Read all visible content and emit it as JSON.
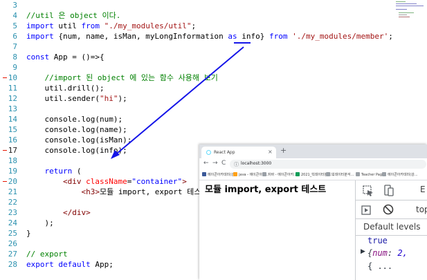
{
  "editor": {
    "lines": [
      {
        "num": "3",
        "tokens": []
      },
      {
        "num": "4",
        "tokens": [
          {
            "t": "//util 은 object 이다.",
            "c": "cm"
          }
        ]
      },
      {
        "num": "5",
        "tokens": [
          {
            "t": "import",
            "c": "kw"
          },
          {
            "t": " util ",
            "c": "pl"
          },
          {
            "t": "from",
            "c": "kw"
          },
          {
            "t": " ",
            "c": "pl"
          },
          {
            "t": "\"./my_modules/util\"",
            "c": "st"
          },
          {
            "t": ";",
            "c": "pl"
          }
        ]
      },
      {
        "num": "6",
        "tokens": [
          {
            "t": "import",
            "c": "kw"
          },
          {
            "t": " {num, name, isMan, myLongInformation ",
            "c": "pl"
          },
          {
            "t": "as",
            "c": "kw"
          },
          {
            "t": " info} ",
            "c": "pl"
          },
          {
            "t": "from",
            "c": "kw"
          },
          {
            "t": " ",
            "c": "pl"
          },
          {
            "t": "'./my_modules/member'",
            "c": "st"
          },
          {
            "t": ";",
            "c": "pl"
          }
        ]
      },
      {
        "num": "7",
        "tokens": []
      },
      {
        "num": "8",
        "tokens": [
          {
            "t": "const",
            "c": "kw"
          },
          {
            "t": " App = ()=>{",
            "c": "pl"
          }
        ]
      },
      {
        "num": "9",
        "tokens": []
      },
      {
        "num": "10",
        "tokens": [
          {
            "t": "    //import 된 object 에 있는 함수 사용해 보기",
            "c": "cm"
          }
        ]
      },
      {
        "num": "11",
        "tokens": [
          {
            "t": "    util.drill();",
            "c": "pl"
          }
        ]
      },
      {
        "num": "12",
        "tokens": [
          {
            "t": "    util.sender(",
            "c": "pl"
          },
          {
            "t": "\"hi\"",
            "c": "st"
          },
          {
            "t": ");",
            "c": "pl"
          }
        ]
      },
      {
        "num": "13",
        "tokens": []
      },
      {
        "num": "14",
        "tokens": [
          {
            "t": "    console.log(num);",
            "c": "pl"
          }
        ]
      },
      {
        "num": "15",
        "tokens": [
          {
            "t": "    console.log(name);",
            "c": "pl"
          }
        ]
      },
      {
        "num": "16",
        "tokens": [
          {
            "t": "    console.log(isMan);",
            "c": "pl"
          }
        ]
      },
      {
        "num": "17",
        "tokens": [
          {
            "t": "    console.log(info);",
            "c": "pl"
          }
        ]
      },
      {
        "num": "18",
        "tokens": []
      },
      {
        "num": "19",
        "tokens": [
          {
            "t": "    ",
            "c": "pl"
          },
          {
            "t": "return",
            "c": "kw"
          },
          {
            "t": " (",
            "c": "pl"
          }
        ]
      },
      {
        "num": "20",
        "tokens": [
          {
            "t": "        <div ",
            "c": "tg"
          },
          {
            "t": "className",
            "c": "at"
          },
          {
            "t": "=",
            "c": "pl"
          },
          {
            "t": "\"container\"",
            "c": "kw"
          },
          {
            "t": ">",
            "c": "tg"
          }
        ]
      },
      {
        "num": "21",
        "tokens": [
          {
            "t": "            <h3>",
            "c": "tg"
          },
          {
            "t": "모듈 import, export 테스",
            "c": "pl"
          }
        ]
      },
      {
        "num": "22",
        "tokens": []
      },
      {
        "num": "23",
        "tokens": [
          {
            "t": "        </div>",
            "c": "tg"
          }
        ]
      },
      {
        "num": "24",
        "tokens": [
          {
            "t": "    );",
            "c": "pl"
          }
        ]
      },
      {
        "num": "25",
        "tokens": [
          {
            "t": "}",
            "c": "pl"
          }
        ]
      },
      {
        "num": "26",
        "tokens": []
      },
      {
        "num": "27",
        "tokens": [
          {
            "t": "// export",
            "c": "cm"
          }
        ]
      },
      {
        "num": "28",
        "tokens": [
          {
            "t": "export",
            "c": "kw"
          },
          {
            "t": " ",
            "c": "pl"
          },
          {
            "t": "default",
            "c": "kw"
          },
          {
            "t": " App;",
            "c": "pl"
          }
        ]
      }
    ],
    "active_line": "17",
    "breakpoint_lines": [
      "10",
      "17",
      "20"
    ]
  },
  "colors": {
    "comment": "#008000",
    "keyword": "#0000ff",
    "string": "#a31515",
    "tag": "#800000",
    "attribute": "#ff0000",
    "annotation_blue": "#1515e8",
    "breakpoint_red": "#e51400"
  },
  "browser": {
    "tab_title": "React App",
    "tab_close": "×",
    "new_tab": "+",
    "nav_back": "←",
    "nav_forward": "→",
    "nav_reload": "C",
    "url_info": "ⓘ",
    "url": "localhost:3000",
    "bookmarks": [
      {
        "label": "에이콘아카데미(강...",
        "color": "#3b5998"
      },
      {
        "label": "java - 에이콘아카...",
        "color": "#ffa116"
      },
      {
        "label": "자바 - 에이콘아카...",
        "color": "#9aa0a6"
      },
      {
        "label": "2021_빅데이터분석...",
        "color": "#0f9d58"
      },
      {
        "label": "빅데이터분석...",
        "color": "#9aa0a6"
      },
      {
        "label": "Teacher Page",
        "color": "#9aa0a6"
      },
      {
        "label": "에이콘아카데미(강...",
        "color": "#9aa0a6"
      }
    ],
    "page_heading": "모듈 import, export 테스트"
  },
  "devtools": {
    "context": "top",
    "levels": "Default levels",
    "log_true": "true",
    "log_obj_prefix": "{",
    "log_obj_key": "num",
    "log_obj_sep": ": ",
    "log_obj_val": "2,",
    "log_more": "{ ..."
  }
}
